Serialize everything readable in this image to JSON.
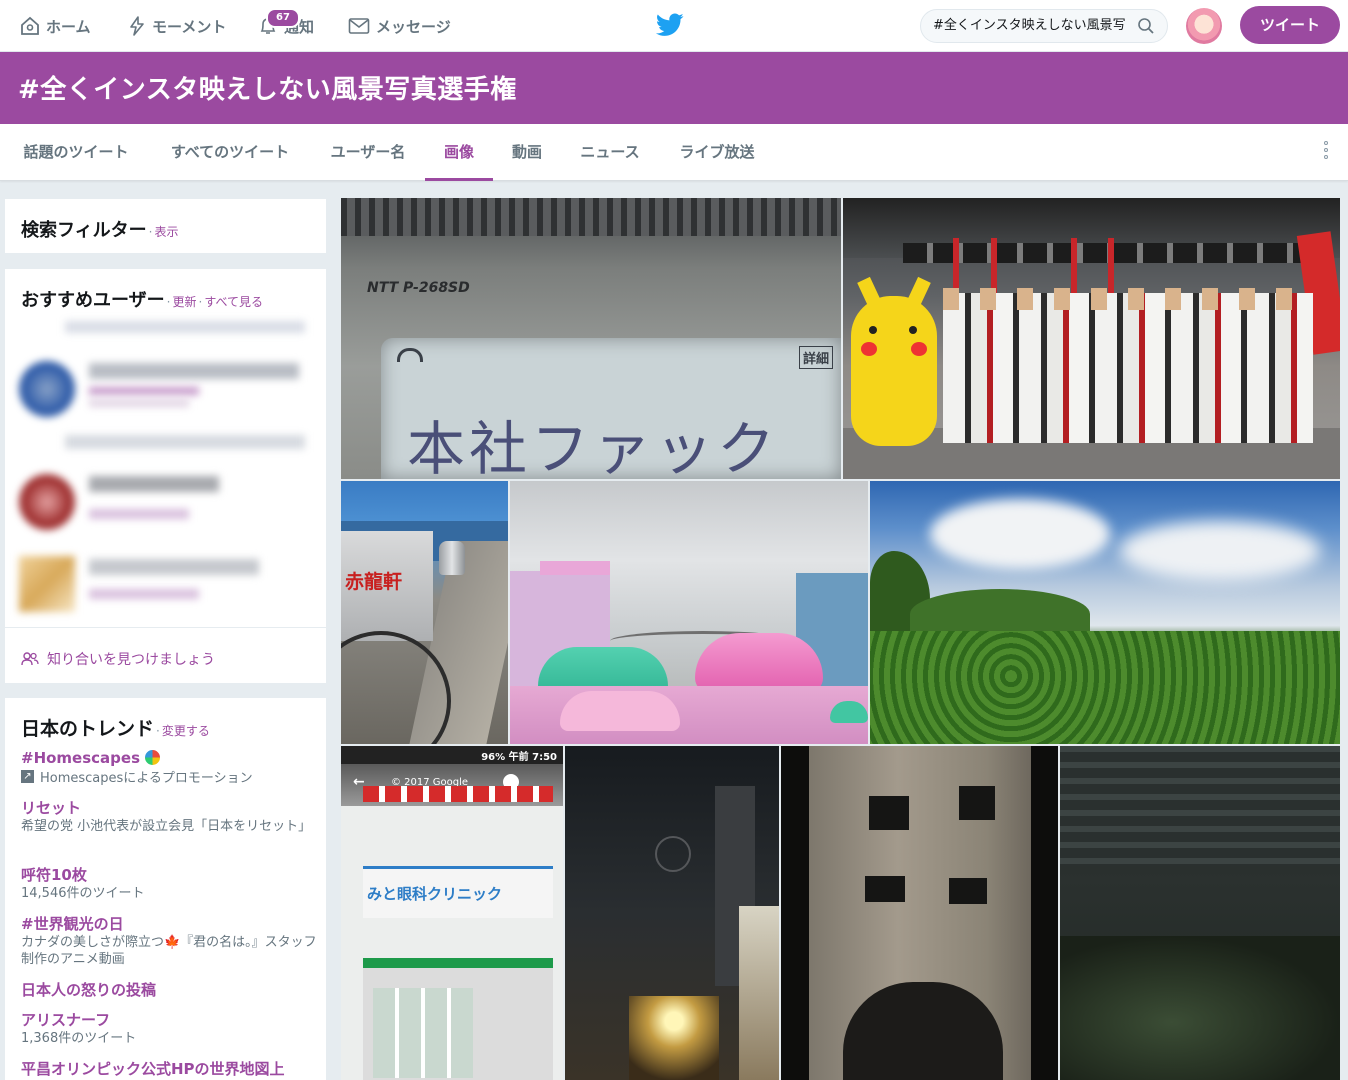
{
  "nav": {
    "home": "ホーム",
    "moments": "モーメント",
    "notifications": "通知",
    "notifications_count": "67",
    "messages": "メッセージ"
  },
  "search": {
    "value": "#全くインスタ映えしない風景写"
  },
  "tweet_button": "ツイート",
  "banner": {
    "title": "#全くインスタ映えしない風景写真選手権"
  },
  "tabs": [
    "話題のツイート",
    "すべてのツイート",
    "ユーザー名",
    "画像",
    "動画",
    "ニュース",
    "ライブ放送"
  ],
  "active_tab": "画像",
  "filter": {
    "title": "検索フィルター",
    "link": "表示"
  },
  "who_to_follow": {
    "title": "おすすめユーザー",
    "refresh": "更新",
    "view_all": "すべて見る",
    "find_friends": "知り合いを見つけましょう"
  },
  "trends": {
    "title": "日本のトレンド",
    "change": "変更する",
    "items": [
      {
        "name": "#Homescapes",
        "desc": "Homescapesによるプロモーション"
      },
      {
        "name": "リセット",
        "desc": "希望の党 小池代表が設立会見「日本をリセット」"
      },
      {
        "name": "呼符10枚",
        "desc": "14,546件のツイート"
      },
      {
        "name": "#世界観光の日",
        "desc": "カナダの美しさが際立つ🍁『君の名は。』スタッフ制作のアニメ動画"
      },
      {
        "name": "日本人の怒りの投稿",
        "desc": ""
      },
      {
        "name": "アリスナーフ",
        "desc": "1,368件のツイート"
      },
      {
        "name": "平昌オリンピック公式HPの世界地図上",
        "desc": ""
      }
    ]
  },
  "photos": {
    "fax_model": "NTT P-268SD",
    "fax_text": "本社ファック",
    "fax_side": "詳細",
    "cart_sign": "赤龍軒",
    "phone_status": "96% 午前 7:50",
    "google_credit": "© 2017 Google",
    "clinic_sign": "みと眼科クリニック"
  },
  "colors": {
    "accent": "#9b4aa0",
    "twitter_blue": "#1da1f2",
    "background": "#e6ecf0"
  }
}
